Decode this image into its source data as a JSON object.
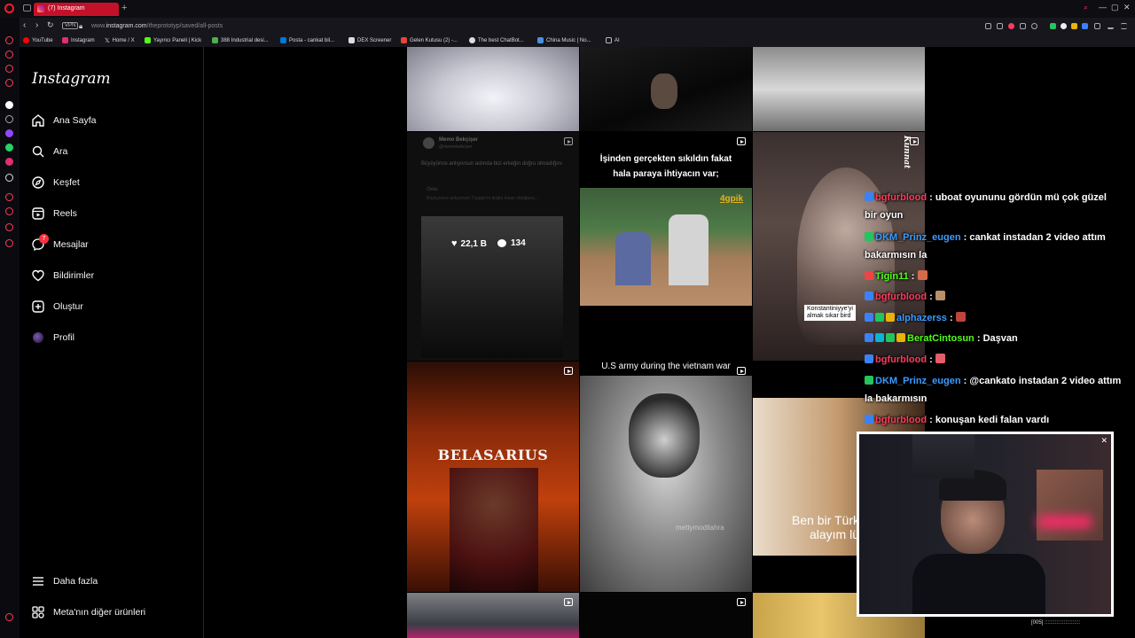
{
  "browser": {
    "tab_title": "(7) Instagram",
    "vpn_label": "VPN",
    "url_prefix": "www.",
    "url_domain": "instagram.com",
    "url_path": "/theprototyp/saved/all-posts",
    "bookmarks": [
      {
        "label": "YouTube",
        "icon": "youtube-icon",
        "color": "#ff0000"
      },
      {
        "label": "Instagram",
        "icon": "instagram-icon",
        "color": "#e1306c"
      },
      {
        "label": "Home / X",
        "icon": "x-icon",
        "color": "#ffffff"
      },
      {
        "label": "Yayıncı Paneli | Kick",
        "icon": "kick-icon",
        "color": "#53fc18"
      },
      {
        "label": "388 Industrial desi...",
        "icon": "page-icon",
        "color": "#4caf50"
      },
      {
        "label": "Posta - cankat bil...",
        "icon": "outlook-icon",
        "color": "#0078d4"
      },
      {
        "label": "DEX Screener",
        "icon": "dex-icon",
        "color": "#dddddd"
      },
      {
        "label": "Gelen Kutusu (2) -...",
        "icon": "gmail-icon",
        "color": "#ea4335"
      },
      {
        "label": "The best ChatBot...",
        "icon": "chatbot-icon",
        "color": "#dddddd"
      },
      {
        "label": "China Music | No...",
        "icon": "page-icon",
        "color": "#4a90e2"
      },
      {
        "label": "AI",
        "icon": "folder-icon",
        "color": "#bbbbbb"
      }
    ]
  },
  "instagram": {
    "logo": "Instagram",
    "nav": [
      {
        "label": "Ana Sayfa",
        "icon": "home-icon"
      },
      {
        "label": "Ara",
        "icon": "search-icon"
      },
      {
        "label": "Keşfet",
        "icon": "compass-icon"
      },
      {
        "label": "Reels",
        "icon": "reels-icon"
      },
      {
        "label": "Mesajlar",
        "icon": "messenger-icon",
        "badge": "7"
      },
      {
        "label": "Bildirimler",
        "icon": "heart-icon"
      },
      {
        "label": "Oluştur",
        "icon": "plus-icon"
      },
      {
        "label": "Profil",
        "icon": "avatar-icon"
      }
    ],
    "more_label": "Daha fazla",
    "meta_label": "Meta'nın diğer ürünleri"
  },
  "posts": {
    "p4_author": "Memo Bekçişer",
    "p4_handle": "@memobekciser",
    "p4_text": "Büyüyünce anlıyorsun aslında bizi erkeğin doğru olmadığını",
    "p4_quote_author": "Özlüz",
    "p4_quote_text": "Büyüyünce anlıyorsun Tuygan'ın doğru insan olduğunu...",
    "p4_likes": "22,1 B",
    "p4_comments": "134",
    "p5_caption": "İşinden gerçekten sıkıldın fakat hala paraya ihtiyacın var;",
    "p5_tag": "4gpik",
    "p6_caption": "Kunnat",
    "p7_title": "BELASARIUS",
    "p8_caption": "U.S army during the vietnam war",
    "p8_watermark": "mettymodilahra",
    "p9_caption": "Ben bir Türk alayım lü"
  },
  "overlay": {
    "konst_line1": "Konstantiniyye'yi",
    "konst_line2": "almak sıkar bird",
    "status": "[005] ::::::::::::::::::::::::",
    "chat": [
      {
        "user": "bgfurblood",
        "user_color": "#ff3b5c",
        "message": ": uboat oyununu gördün mü çok güzel bir oyun",
        "badges": [
          "#3b82f6"
        ]
      },
      {
        "user": "DKM_Prinz_eugen",
        "user_color": "#3b9bff",
        "message": ": cankat instadan 2 video attım bakarmısın la",
        "badges": [
          "#22c55e"
        ]
      },
      {
        "user": "Tigin11",
        "user_color": "#53fc18",
        "message": ":",
        "badges": [
          "#ef4444"
        ],
        "emote": true
      },
      {
        "user": "bgfurblood",
        "user_color": "#ff3b5c",
        "message": ":",
        "badges": [
          "#3b82f6"
        ],
        "emote": true
      },
      {
        "user": "alphazerss",
        "user_color": "#3b9bff",
        "message": ":",
        "badges": [
          "#3b82f6",
          "#22c55e",
          "#eab308"
        ],
        "emote": true
      },
      {
        "user": "BeratCintosun",
        "user_color": "#53fc18",
        "message": ": Daşvan",
        "badges": [
          "#3b82f6",
          "#06b6d4",
          "#22c55e",
          "#eab308"
        ]
      },
      {
        "user": "bgfurblood",
        "user_color": "#ff3b5c",
        "message": ":",
        "badges": [
          "#3b82f6"
        ],
        "emote": true
      },
      {
        "user": "DKM_Prinz_eugen",
        "user_color": "#3b9bff",
        "message": ": @cankato instadan 2 video attım la bakarmısın",
        "badges": [
          "#22c55e"
        ]
      },
      {
        "user": "bgfurblood",
        "user_color": "#ff3b5c",
        "message": ": konuşan kedi falan vardı",
        "badges": [
          "#3b82f6"
        ]
      }
    ]
  }
}
